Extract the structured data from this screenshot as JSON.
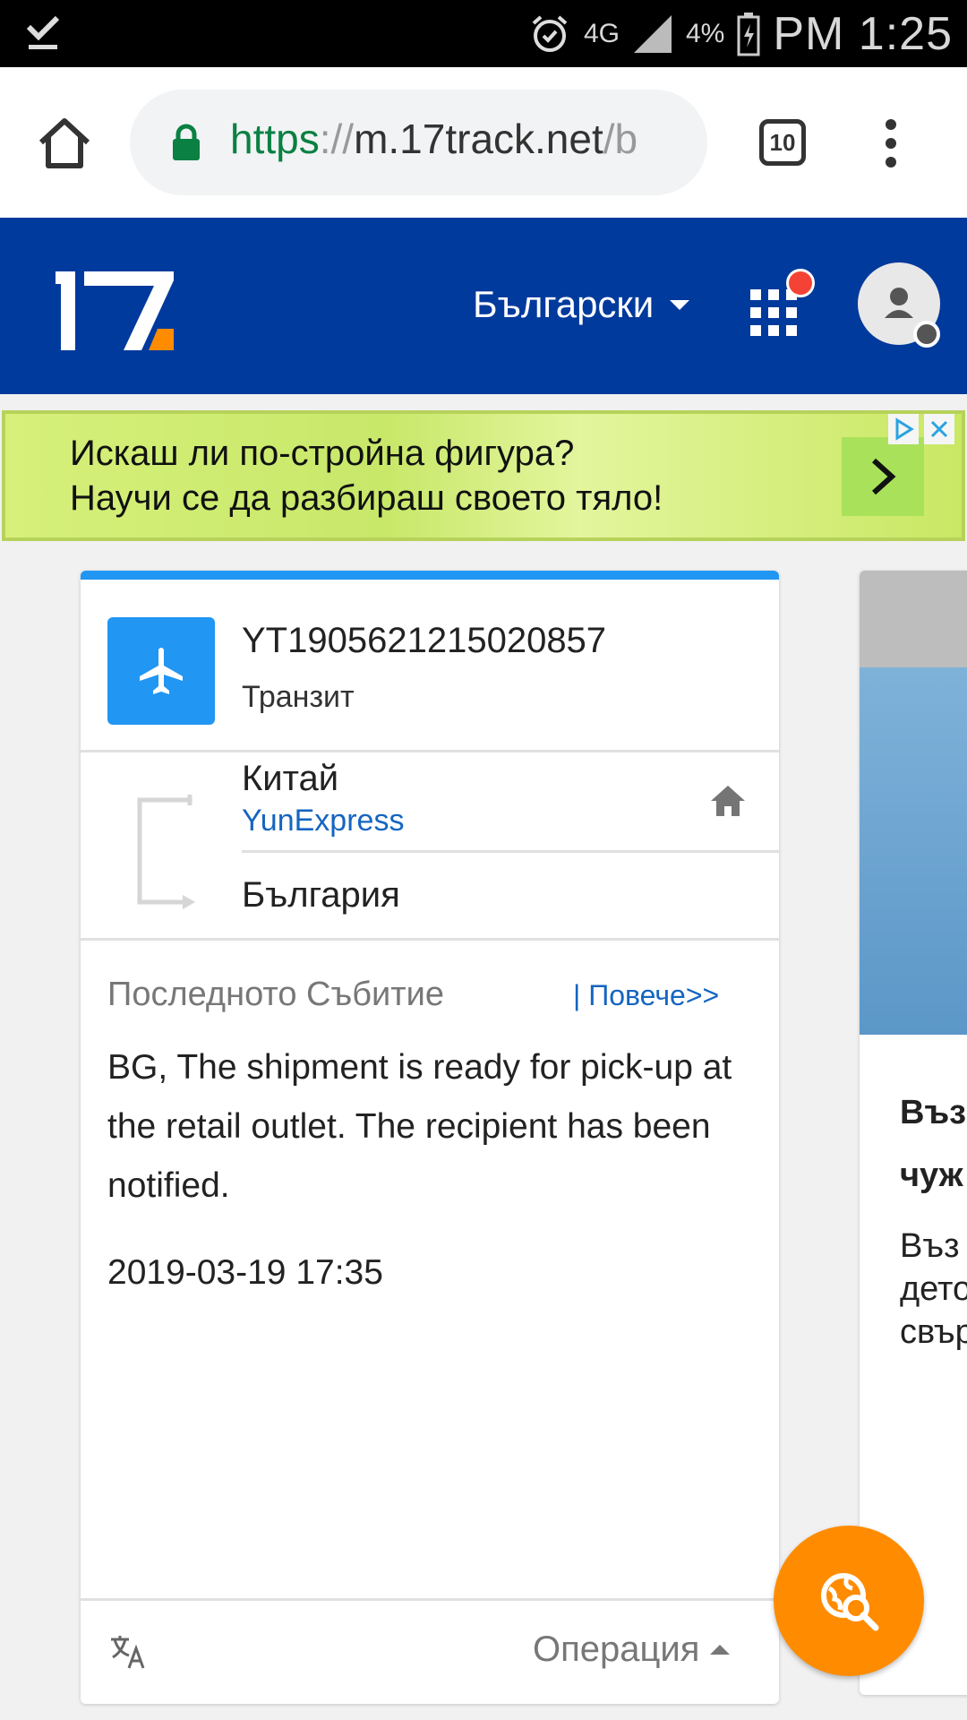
{
  "status_bar": {
    "network": "4G",
    "battery": "4%",
    "time": "PM 1:25"
  },
  "browser": {
    "url_scheme": "https",
    "url_sep": "://",
    "url_host": "m.17track.net",
    "url_path": "/b",
    "tab_count": "10"
  },
  "header": {
    "language": "Български"
  },
  "ad": {
    "line1": "Искаш ли по-стройна фигура?",
    "line2": "Научи се да разбираш своето тяло!"
  },
  "card": {
    "tracking_number": "YT1905621215020857",
    "status": "Транзит",
    "origin": "Китай",
    "carrier": "YunExpress",
    "destination": "България",
    "last_event_label": "Последното Събитие",
    "more_link": "| Повече>>",
    "event_text": "BG, The shipment is ready for pick-up at the retail outlet. The recipient has been notified.",
    "event_time": "2019-03-19 17:35",
    "operation_label": "Операция"
  },
  "side_card": {
    "title": "Въз\nчуж",
    "text": "Въз\nдето\nсвър"
  },
  "colors": {
    "header_bg": "#003a9c",
    "accent_blue": "#2196f3",
    "fab": "#ff8c00",
    "link": "#1565c0"
  }
}
